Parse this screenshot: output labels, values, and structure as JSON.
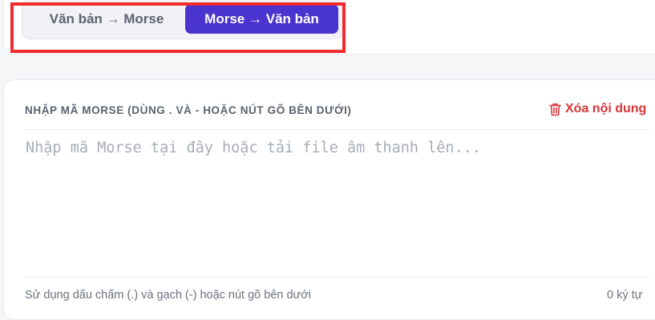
{
  "mode_toggle": {
    "text_to_morse_label": "Văn bản → Morse",
    "morse_to_text_label": "Morse → Văn bản",
    "active": "morse_to_text"
  },
  "editor": {
    "label": "NHẬP MÃ MORSE (DÙNG . VÀ - HOẶC NÚT GÕ BÊN DƯỚI)",
    "clear_label": "Xóa nội dung",
    "clear_icon": "trash-icon",
    "input_value": "",
    "input_placeholder": "Nhập mã Morse tại đây hoặc tải file âm thanh lên...",
    "hint": "Sử dụng dấu chấm (.) và gạch (-) hoặc nút gõ bên dưới",
    "char_count": "0 ký tự"
  },
  "colors": {
    "accent": "#4a34cf",
    "danger": "#d8353a",
    "highlight": "#ef2b2b"
  }
}
